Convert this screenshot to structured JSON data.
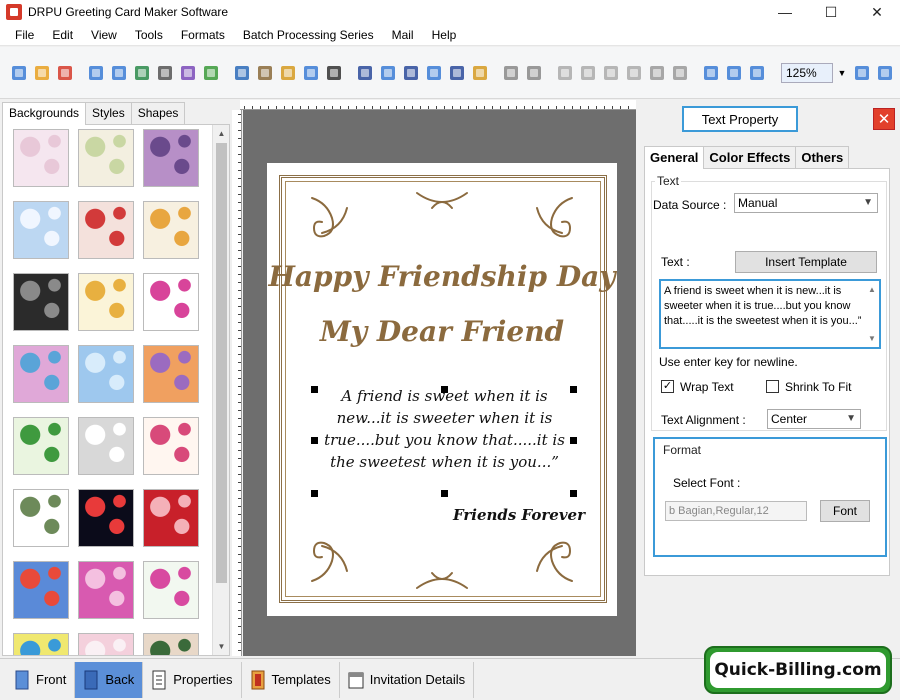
{
  "window": {
    "title": "DRPU Greeting Card Maker Software",
    "minimize": "—",
    "maximize": "☐",
    "close": "✕"
  },
  "menu": [
    "File",
    "Edit",
    "View",
    "Tools",
    "Formats",
    "Batch Processing Series",
    "Mail",
    "Help"
  ],
  "toolbar": {
    "zoom_value": "125%",
    "icons": [
      "new-icon",
      "open-icon",
      "close-file-icon",
      "save-icon",
      "save-as-icon",
      "export-icon",
      "print-icon",
      "print-preview-icon",
      "crop-icon",
      "image-icon",
      "pen-icon",
      "picture-icon",
      "watermark-icon",
      "barcode-icon",
      "text-icon",
      "text-box-icon",
      "signature-icon",
      "email-icon",
      "line-icon",
      "database-icon",
      "undo-icon",
      "redo-icon",
      "cut-icon",
      "copy-icon",
      "paste-icon",
      "delete-icon",
      "bring-front-icon",
      "send-back-icon",
      "grid-icon",
      "actual-size-icon",
      "fit-icon",
      "zoom-in-icon",
      "zoom-out-icon"
    ]
  },
  "left_panel": {
    "tabs": [
      "Backgrounds",
      "Styles",
      "Shapes"
    ],
    "active_tab": "Backgrounds",
    "thumbnails": [
      [
        "#f5e6ef",
        "#e8c8d8"
      ],
      [
        "#f3efe0",
        "#c9d7a3"
      ],
      [
        "#b78fc7",
        "#6a4a8c"
      ],
      [
        "#bcd7f2",
        "#f0f6ff"
      ],
      [
        "#f4e1dc",
        "#d23a3a"
      ],
      [
        "#f7f0e0",
        "#e8a640"
      ],
      [
        "#2b2b2b",
        "#8a8a8a"
      ],
      [
        "#fbf4d8",
        "#e8b040"
      ],
      [
        "#ffffff",
        "#d8449a"
      ],
      [
        "#e0a8d8",
        "#5aa4d8"
      ],
      [
        "#9ec8ee",
        "#d8ecfb"
      ],
      [
        "#f0a060",
        "#9b6bc0"
      ],
      [
        "#eaf5e0",
        "#3f9a3f"
      ],
      [
        "#d8d8d8",
        "#ffffff"
      ],
      [
        "#fff6f0",
        "#d84a7a"
      ],
      [
        "#ffffff",
        "#6d8a5a"
      ],
      [
        "#0b0b1a",
        "#e83a3a"
      ],
      [
        "#c8202a",
        "#f4b0b8"
      ],
      [
        "#5a8ad8",
        "#e84a3a"
      ],
      [
        "#d85ab0",
        "#f4c0e0"
      ],
      [
        "#f2f8f0",
        "#d84aa0"
      ],
      [
        "#f0e870",
        "#3a9ad8"
      ],
      [
        "#f4d0dc",
        "#faf0f4"
      ],
      [
        "#e8d8c8",
        "#3a6a3a"
      ]
    ]
  },
  "canvas": {
    "card": {
      "line1": "Happy Friendship Day",
      "line2": "My Dear Friend",
      "body": "A friend is sweet when it is new...it is sweeter when it is true....but you know that.....it is the sweetest when it is you...”",
      "signature": "Friends Forever",
      "accent": "#8b6a3e"
    }
  },
  "right_panel": {
    "title": "Text Property",
    "close": "✕",
    "tabs": [
      "General",
      "Color Effects",
      "Others"
    ],
    "active_tab": "General",
    "group_text": "Text",
    "data_source_label": "Data Source :",
    "data_source_value": "Manual",
    "text_label": "Text :",
    "insert_template_button": "Insert Template",
    "text_value": "A friend is sweet when it is new...it is sweeter when it is true....but you know that.....it is the sweetest when it is you...”",
    "hint": "Use enter key for newline.",
    "wrap_text_label": "Wrap Text",
    "wrap_text_checked": "✓",
    "shrink_label": "Shrink To Fit",
    "alignment_label": "Text Alignment :",
    "alignment_value": "Center",
    "group_format": "Format",
    "select_font_label": "Select Font :",
    "font_value": "b Bagian,Regular,12",
    "font_button": "Font",
    "highlight_color": "#3b9ad8"
  },
  "bottom": {
    "buttons": [
      "Front",
      "Back",
      "Properties",
      "Templates",
      "Invitation Details"
    ],
    "active": "Back",
    "logo": "Quick-Billing.com"
  }
}
